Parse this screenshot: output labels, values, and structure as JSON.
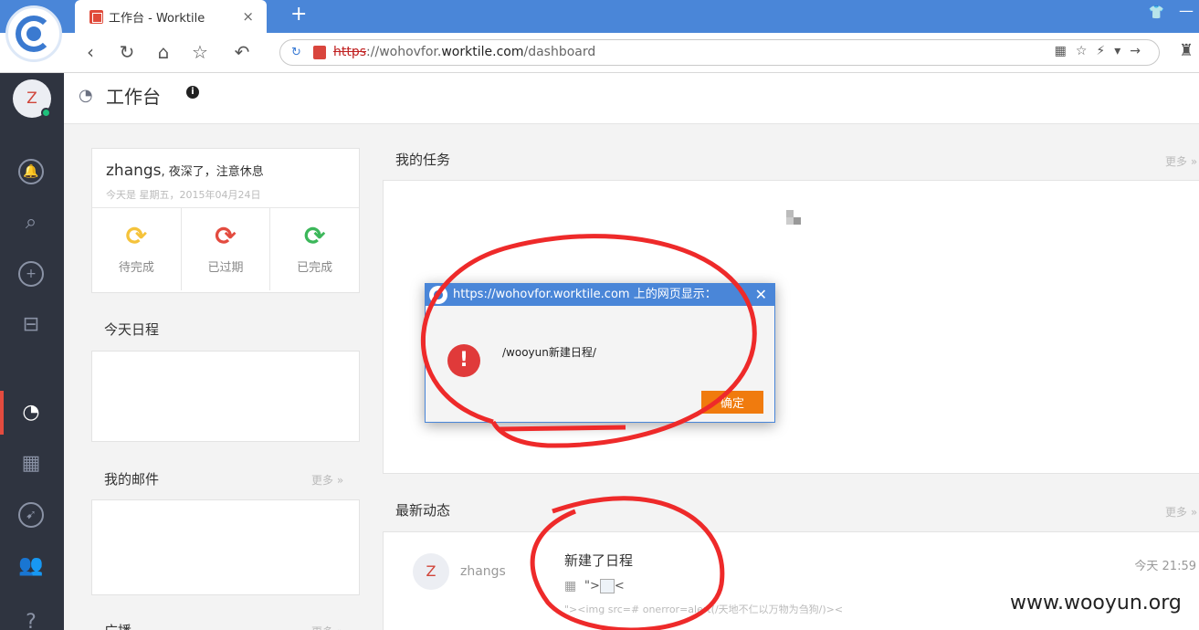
{
  "browser": {
    "tab_title": "工作台 - Worktile",
    "tab_close": "×",
    "new_tab": "+",
    "url_scheme": "https",
    "url_sep": "://wohovfor.",
    "url_domain": "worktile.com",
    "url_path": "/dashboard"
  },
  "sidebar": {
    "avatar_letter": "Z",
    "items": [
      "notifications",
      "search",
      "add",
      "inbox",
      "dashboard",
      "calendar",
      "explore",
      "contacts",
      "help"
    ]
  },
  "header": {
    "title": "工作台"
  },
  "greeting": {
    "name": "zhangs",
    "message": ", 夜深了，注意休息",
    "date": "今天是 星期五，2015年04月24日"
  },
  "stats": [
    {
      "label": "待完成",
      "color": "#f5c33b"
    },
    {
      "label": "已过期",
      "color": "#e34b3f"
    },
    {
      "label": "已完成",
      "color": "#3cb75a"
    }
  ],
  "sections": {
    "schedule": "今天日程",
    "mail": "我的邮件",
    "broadcast": "广播",
    "tasks": "我的任务",
    "activity": "最新动态",
    "more": "更多"
  },
  "dialog": {
    "title": "https://wohovfor.worktile.com 上的网页显示：",
    "message": "/wooyun新建日程/",
    "ok": "确定"
  },
  "activity": {
    "avatar_letter": "Z",
    "user": "zhangs",
    "title": "新建了日程",
    "inline_prefix": "\">",
    "inline_suffix": "<",
    "code": "\"><img src=# onerror=alert(/天地不仁以万物为刍狗/)><",
    "time": "今天 21:59"
  },
  "watermark": "www.wooyun.org"
}
